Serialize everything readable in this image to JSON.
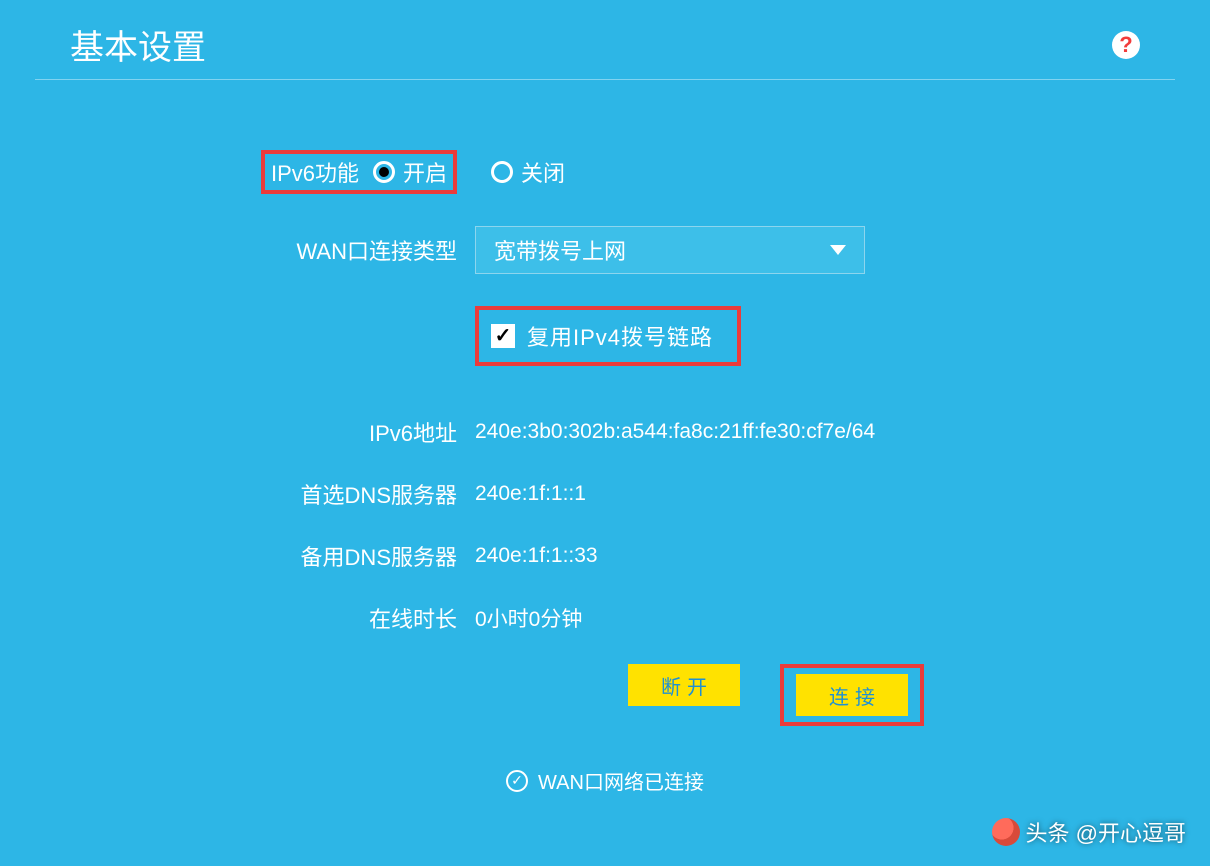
{
  "header": {
    "title": "基本设置"
  },
  "ipv6_feature": {
    "label": "IPv6功能",
    "on_label": "开启",
    "off_label": "关闭",
    "selected": "on"
  },
  "wan": {
    "label": "WAN口连接类型",
    "selected_value": "宽带拨号上网"
  },
  "reuse_ipv4": {
    "label": "复用IPv4拨号链路",
    "checked": true
  },
  "info": {
    "ipv6_addr_label": "IPv6地址",
    "ipv6_addr_value": "240e:3b0:302b:a544:fa8c:21ff:fe30:cf7e/64",
    "primary_dns_label": "首选DNS服务器",
    "primary_dns_value": "240e:1f:1::1",
    "secondary_dns_label": "备用DNS服务器",
    "secondary_dns_value": "240e:1f:1::33",
    "online_time_label": "在线时长",
    "online_time_value": "0小时0分钟"
  },
  "buttons": {
    "disconnect": "断开",
    "connect": "连接"
  },
  "status": {
    "text": "WAN口网络已连接"
  },
  "watermark": {
    "text": "头条 @开心逗哥"
  }
}
